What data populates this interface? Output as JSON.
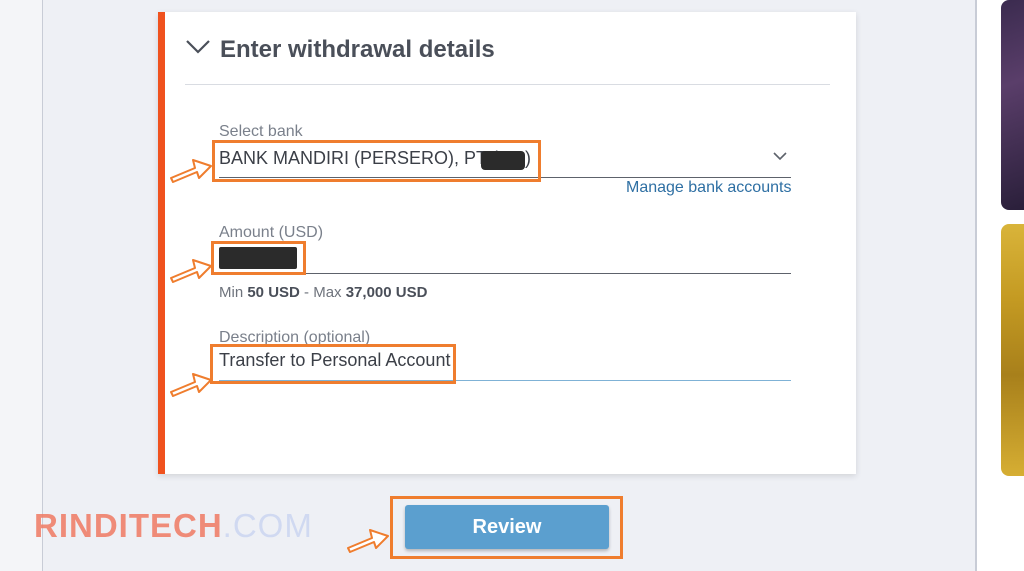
{
  "section": {
    "title": "Enter withdrawal details"
  },
  "bank": {
    "label": "Select bank",
    "value_prefix": "BANK MANDIRI (PERSERO), PT (",
    "value_suffix": ")",
    "manage_link": "Manage bank accounts"
  },
  "amount": {
    "label": "Amount (USD)",
    "hint_min_prefix": "Min ",
    "hint_min_value": "50 USD",
    "hint_sep": " - Max ",
    "hint_max_value": "37,000 USD"
  },
  "description": {
    "label": "Description (optional)",
    "value": "Transfer to Personal Account"
  },
  "review_button": "Review",
  "watermark": {
    "part1": "RINDITECH",
    "part2": ".COM"
  },
  "colors": {
    "accent": "#f0521e",
    "highlight": "#ef7d2e",
    "button": "#5b9fcf",
    "link": "#2e6fa3"
  }
}
